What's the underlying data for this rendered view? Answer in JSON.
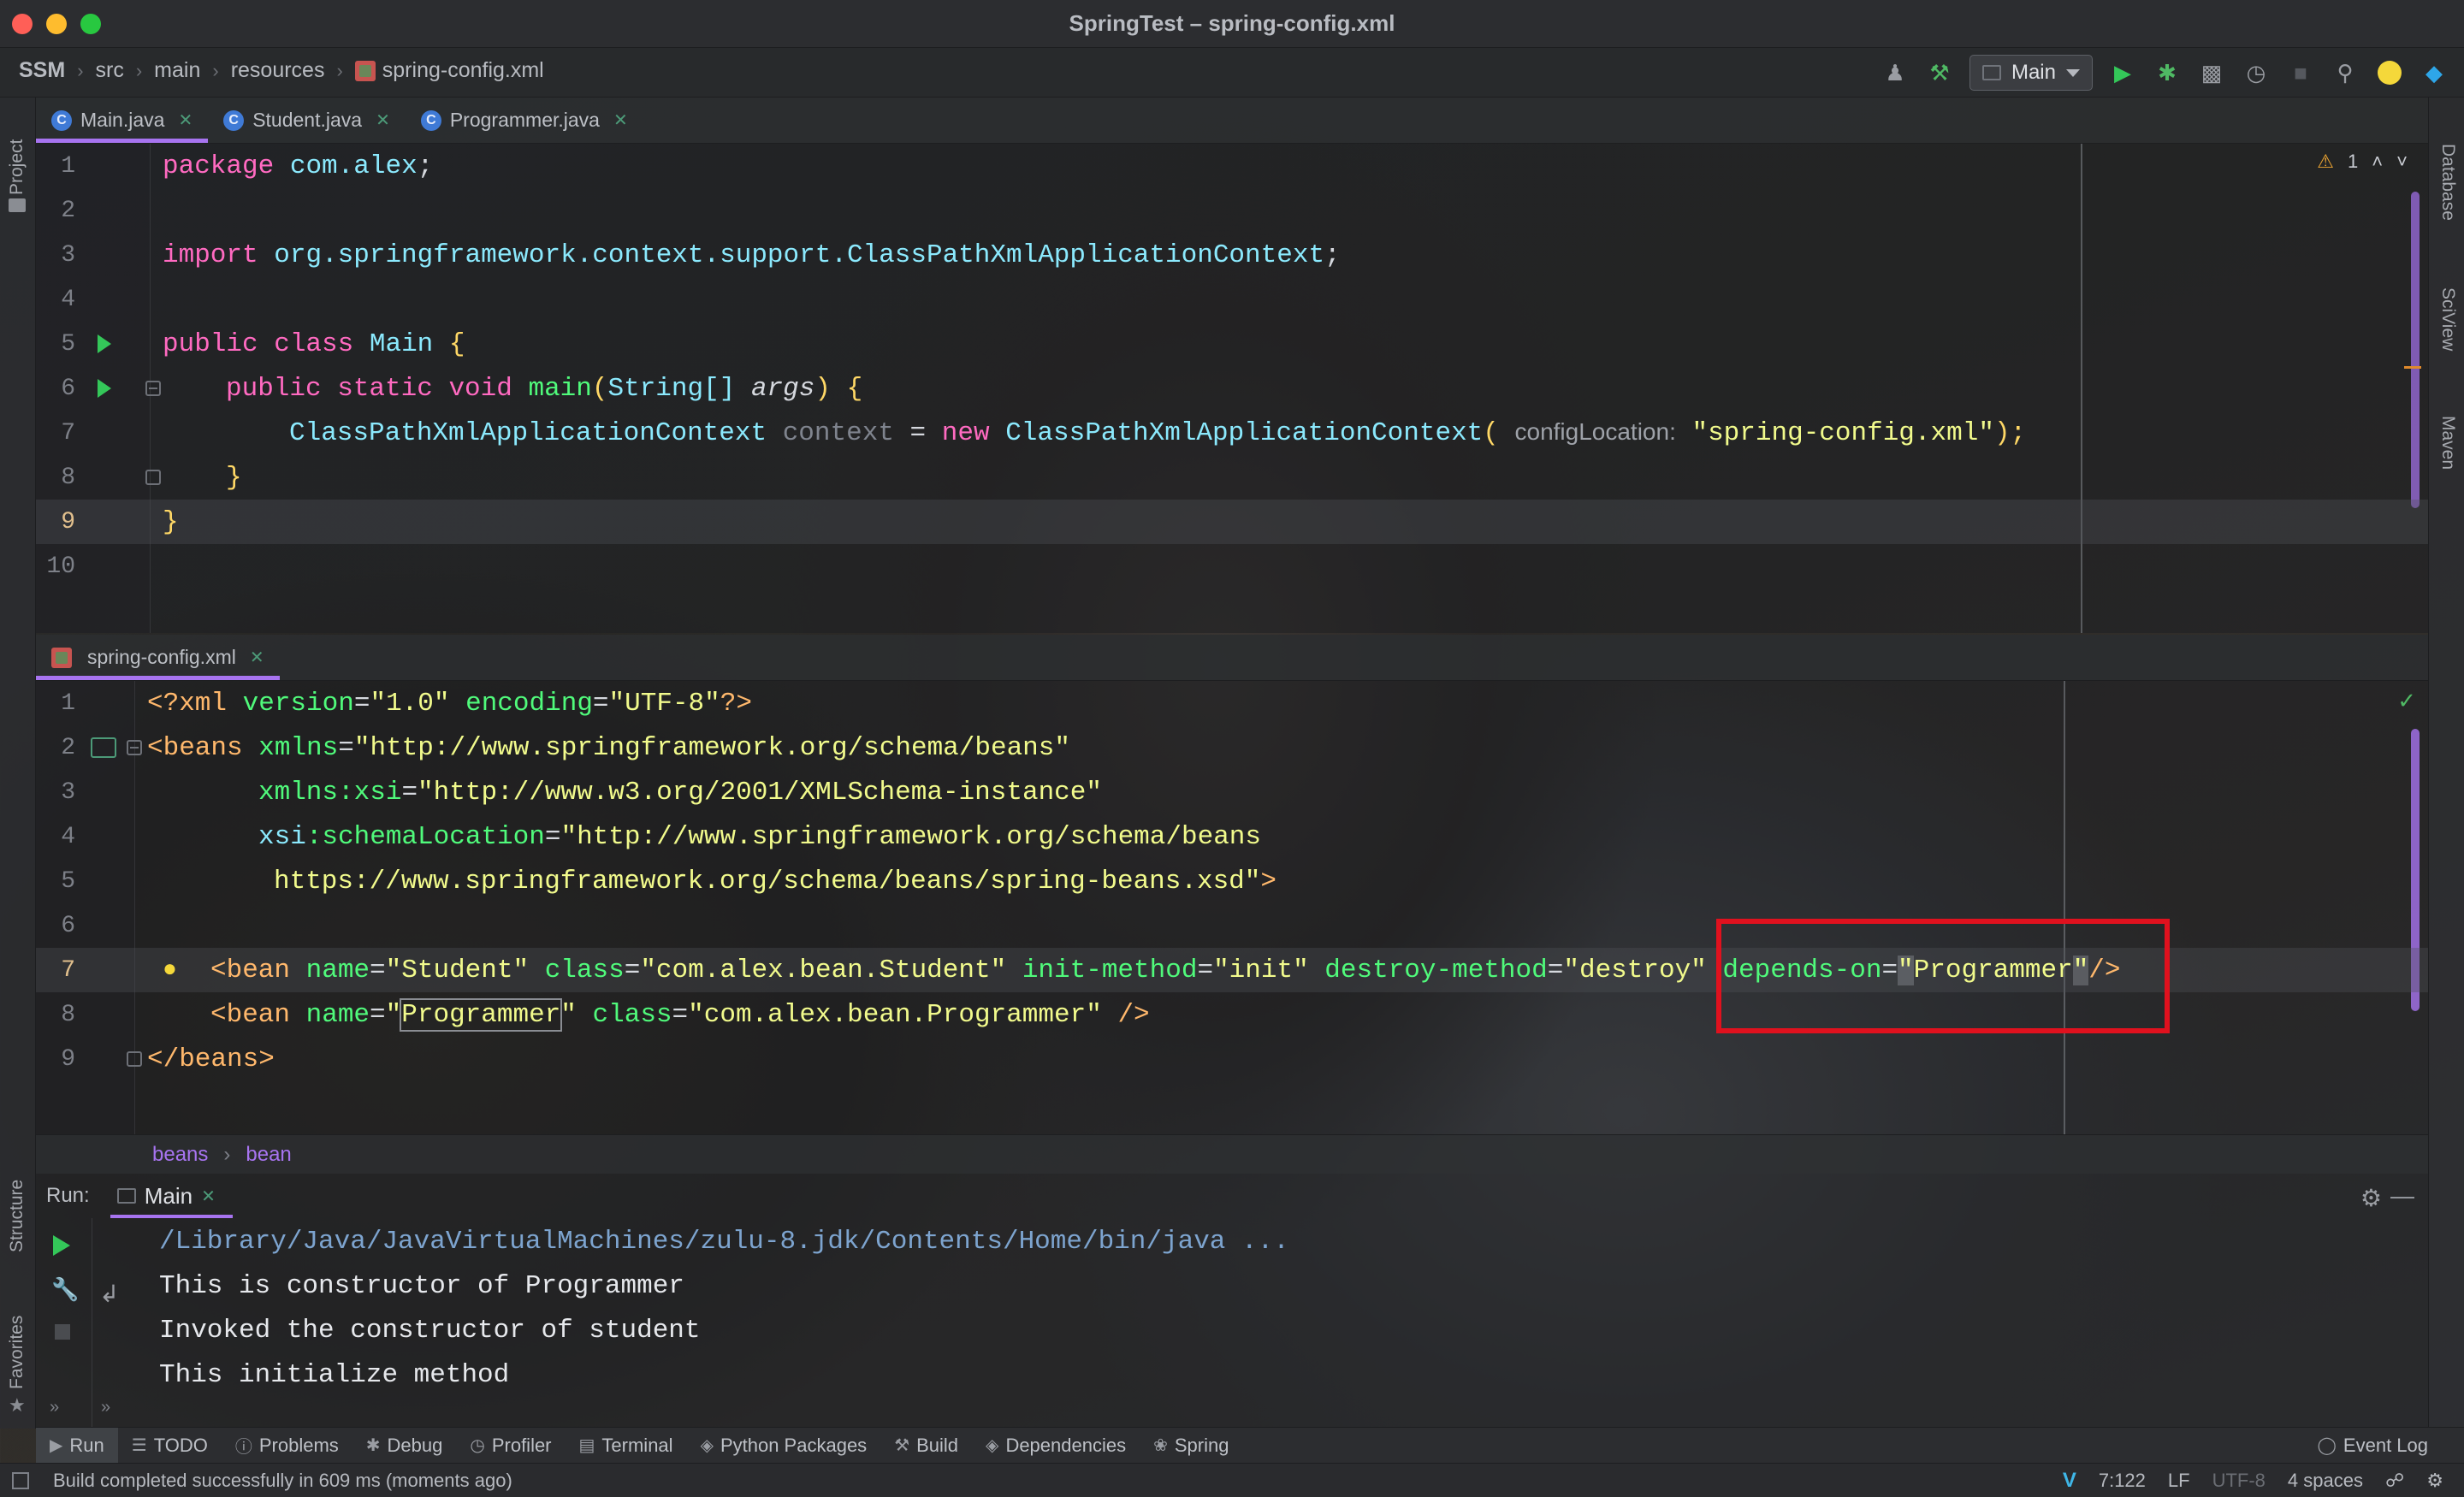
{
  "window": {
    "title": "SpringTest – spring-config.xml"
  },
  "breadcrumb": [
    "SSM",
    "src",
    "main",
    "resources",
    "spring-config.xml"
  ],
  "toolbar": {
    "run_config": "Main"
  },
  "left_strip": {
    "project": "Project",
    "structure": "Structure",
    "favorites": "Favorites"
  },
  "right_strip": {
    "database": "Database",
    "sciview": "SciView",
    "maven": "Maven"
  },
  "top_editor": {
    "tabs": [
      {
        "label": "Main.java",
        "icon": "C"
      },
      {
        "label": "Student.java",
        "icon": "C"
      },
      {
        "label": "Programmer.java",
        "icon": "C"
      }
    ],
    "warning_count": "1",
    "line_numbers": [
      "1",
      "2",
      "3",
      "4",
      "5",
      "6",
      "7",
      "8",
      "9",
      "10"
    ],
    "code": {
      "l1_kw": "package",
      "l1_pkg": "com.alex",
      "l1_end": ";",
      "l3_kw": "import",
      "l3_pkg": "org.springframework.context.support.",
      "l3_cls": "ClassPathXmlApplicationContext",
      "l3_end": ";",
      "l5_kw": "public class",
      "l5_cls": "Main",
      "l5_br": "{",
      "l6_kw": "public static void",
      "l6_fn": "main",
      "l6_p1": "(",
      "l6_type": "String[]",
      "l6_arg": "args",
      "l6_p2": ")",
      "l6_br": "{",
      "l7_type": "ClassPathXmlApplicationContext",
      "l7_var": "context",
      "l7_eq": "=",
      "l7_new": "new",
      "l7_cls": "ClassPathXmlApplicationContext",
      "l7_p1": "(",
      "l7_hint": "configLocation:",
      "l7_str": "\"spring-config.xml\"",
      "l7_end": ");",
      "l8_br": "}",
      "l9_br": "}"
    }
  },
  "bottom_editor": {
    "tab": "spring-config.xml",
    "line_numbers": [
      "1",
      "2",
      "3",
      "4",
      "5",
      "6",
      "7",
      "8",
      "9"
    ],
    "xml": {
      "l1_open": "<?xml",
      "l1_a1": "version",
      "l1_v1": "\"1.0\"",
      "l1_a2": "encoding",
      "l1_v2": "\"UTF-8\"",
      "l1_close": "?>",
      "l2_tag": "<beans",
      "l2_a": "xmlns",
      "l2_v": "\"http://www.springframework.org/schema/beans\"",
      "l3_ns": "xmlns:xsi",
      "l3_v": "\"http://www.w3.org/2001/XMLSchema-instance\"",
      "l4_ns": "xsi",
      "l4_a": ":schemaLocation",
      "l4_v": "\"http://www.springframework.org/schema/beans",
      "l5_v": "https://www.springframework.org/schema/beans/spring-beans.xsd\"",
      "l5_close": ">",
      "l7_tag": "<bean",
      "l7_a1": "name",
      "l7_v1": "\"Student\"",
      "l7_a2": "class",
      "l7_v2": "\"com.alex.bean.Student\"",
      "l7_a3": "init-method",
      "l7_v3": "\"init\"",
      "l7_a4": "destroy-method",
      "l7_v4": "\"destroy\"",
      "l7_a5": "depends-on",
      "l7_q1": "\"",
      "l7_v5": "Programmer",
      "l7_q2": "\"",
      "l7_close": "/>",
      "l8_tag": "<bean",
      "l8_a1": "name",
      "l8_q1": "\"",
      "l8_v1": "Programmer",
      "l8_q2": "\"",
      "l8_a2": "class",
      "l8_v2": "\"com.alex.bean.Programmer\"",
      "l8_close": "/>",
      "l9_tag": "</beans>"
    },
    "crumbs": [
      "beans",
      "bean"
    ]
  },
  "run_panel": {
    "label": "Run:",
    "tab": "Main",
    "output": [
      "/Library/Java/JavaVirtualMachines/zulu-8.jdk/Contents/Home/bin/java ...",
      "This is constructor of Programmer",
      "Invoked the constructor of student",
      "This initialize method"
    ]
  },
  "tool_windows": [
    "Run",
    "TODO",
    "Problems",
    "Debug",
    "Profiler",
    "Terminal",
    "Python Packages",
    "Build",
    "Dependencies",
    "Spring"
  ],
  "event_log": "Event Log",
  "status": {
    "message": "Build completed successfully in 609 ms (moments ago)",
    "position": "7:122",
    "line_sep": "LF",
    "encoding": "UTF-8",
    "indent": "4 spaces"
  },
  "colors": {
    "accent": "#a774f0",
    "highlight_box": "#e0111e",
    "run_green": "#34c759"
  }
}
